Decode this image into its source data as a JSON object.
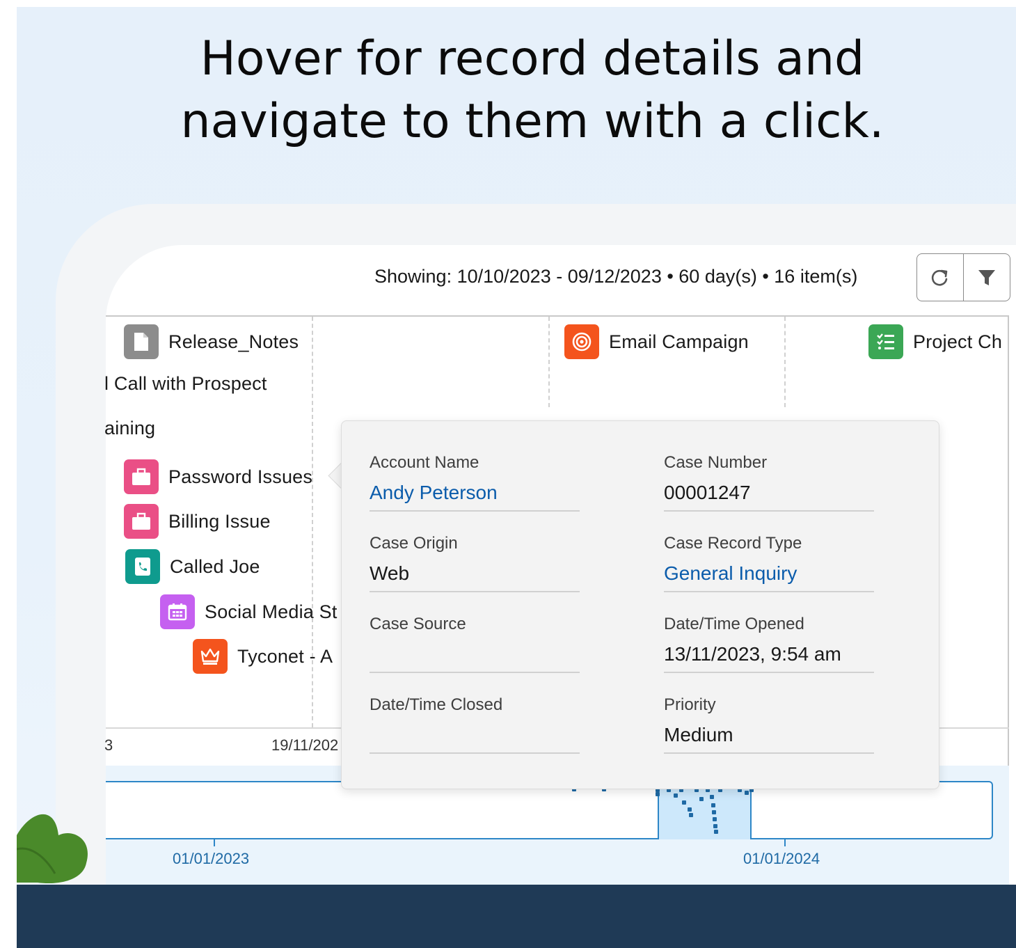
{
  "headline": {
    "line1": "Hover for record details and",
    "line2": "navigate to them with a click."
  },
  "toolbar": {
    "showing_text": "Showing: 10/10/2023 - 09/12/2023 • 60 day(s) • 16 item(s)",
    "refresh_icon": "refresh-icon",
    "filter_icon": "filter-icon"
  },
  "timeline": {
    "items": [
      {
        "label": "Release_Notes",
        "icon": "document-icon",
        "color": "#8c8c8c"
      },
      {
        "label": "Email Campaign",
        "icon": "target-icon",
        "color": "#f4541d"
      },
      {
        "label": "Project Ch",
        "icon": "checklist-icon",
        "color": "#3ba755"
      },
      {
        "label": "l Call with Prospect",
        "icon": "",
        "color": ""
      },
      {
        "label": "aining",
        "icon": "",
        "color": ""
      },
      {
        "label": "Password Issues",
        "icon": "briefcase-icon",
        "color": "#ea4f86"
      },
      {
        "label": "Billing Issue",
        "icon": "briefcase-icon",
        "color": "#ea4f86"
      },
      {
        "label": "Called Joe",
        "icon": "phone-log-icon",
        "color": "#0f9b8e"
      },
      {
        "label": "Social Media St",
        "icon": "calendar-icon",
        "color": "#c560f0"
      },
      {
        "label": "Tyconet - A",
        "icon": "crown-icon",
        "color": "#f4541d"
      }
    ],
    "axis_labels": [
      "3",
      "19/11/202"
    ]
  },
  "overview": {
    "labels": [
      "01/01/2023",
      "01/01/2024"
    ]
  },
  "popover": {
    "fields": [
      {
        "label": "Account Name",
        "value": "Andy Peterson",
        "link": true
      },
      {
        "label": "Case Number",
        "value": "00001247",
        "link": false
      },
      {
        "label": "Case Origin",
        "value": "Web",
        "link": false
      },
      {
        "label": "Case Record Type",
        "value": "General Inquiry",
        "link": true
      },
      {
        "label": "Case Source",
        "value": "",
        "link": false
      },
      {
        "label": "Date/Time Opened",
        "value": "13/11/2023, 9:54 am",
        "link": false
      },
      {
        "label": "Date/Time Closed",
        "value": "",
        "link": false
      },
      {
        "label": "Priority",
        "value": "Medium",
        "link": false
      }
    ]
  },
  "colors": {
    "link": "#0b5cab",
    "accent_blue": "#2d86c7",
    "footer": "#1f3a56"
  }
}
